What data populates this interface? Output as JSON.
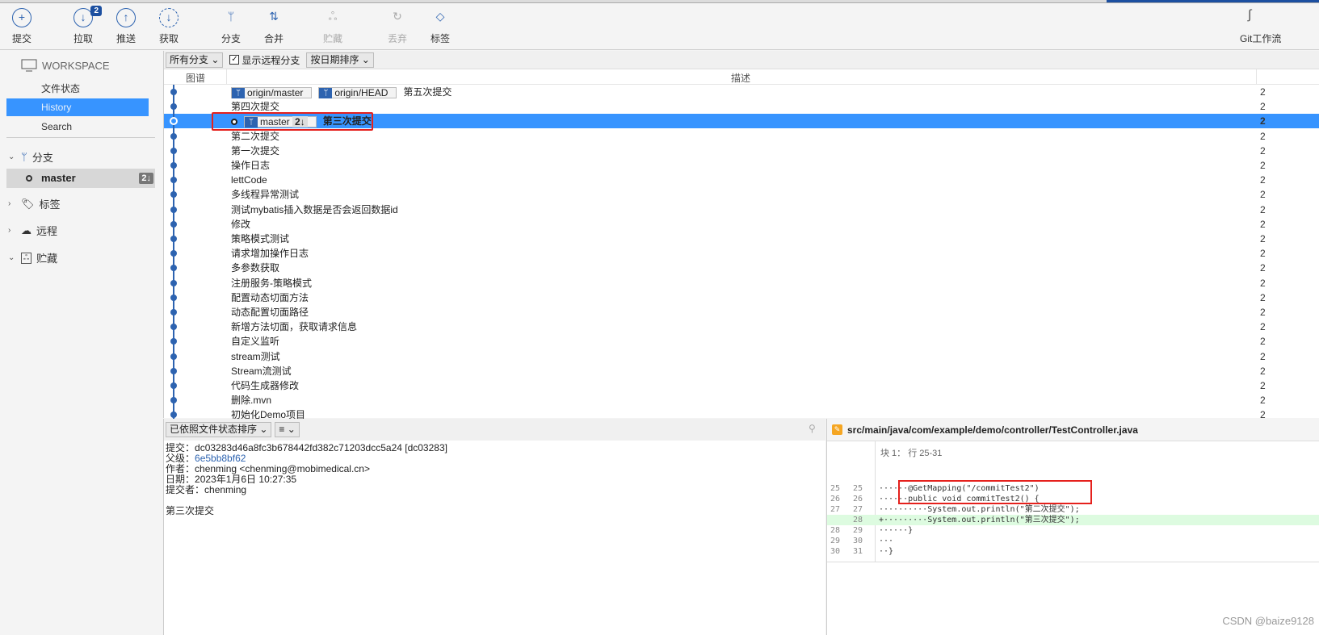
{
  "toolbar": {
    "items": [
      {
        "label": "提交",
        "icon": "plus-circle-icon"
      },
      {
        "label": "拉取",
        "icon": "pull-icon",
        "badge": "2"
      },
      {
        "label": "推送",
        "icon": "push-icon"
      },
      {
        "label": "获取",
        "icon": "fetch-icon"
      },
      {
        "label": "分支",
        "icon": "branch-icon"
      },
      {
        "label": "合并",
        "icon": "merge-icon"
      },
      {
        "label": "贮藏",
        "icon": "stash-icon",
        "disabled": true
      },
      {
        "label": "丢弃",
        "icon": "discard-icon",
        "disabled": true
      },
      {
        "label": "标签",
        "icon": "tag-icon"
      }
    ],
    "git_flow": "Git工作流"
  },
  "sidebar": {
    "workspace": "WORKSPACE",
    "items": [
      "文件状态",
      "History",
      "Search"
    ],
    "selected": "History",
    "branches": "分支",
    "master": "master",
    "master_count": "2↓",
    "tags": "标签",
    "remotes": "远程",
    "stashes": "贮藏"
  },
  "filter": {
    "branches": "所有分支",
    "show_remote": "显示远程分支",
    "show_remote_checked": true,
    "sort": "按日期排序"
  },
  "columns": {
    "graph": "图谱",
    "desc": "描述",
    "date": "2"
  },
  "commits": [
    {
      "desc": "第五次提交",
      "refs": [
        "origin/master",
        "origin/HEAD"
      ]
    },
    {
      "desc": "第四次提交"
    },
    {
      "desc": "第三次提交",
      "refs": [
        "master"
      ],
      "ref_count": "2↓",
      "selected": true,
      "head": true
    },
    {
      "desc": "第二次提交"
    },
    {
      "desc": "第一次提交"
    },
    {
      "desc": "操作日志"
    },
    {
      "desc": "lettCode"
    },
    {
      "desc": "多线程异常测试"
    },
    {
      "desc": "测试mybatis插入数据是否会返回数据id"
    },
    {
      "desc": "修改"
    },
    {
      "desc": "策略模式测试"
    },
    {
      "desc": "请求增加操作日志"
    },
    {
      "desc": "多参数获取"
    },
    {
      "desc": "注册服务-策略模式"
    },
    {
      "desc": "配置动态切面方法"
    },
    {
      "desc": "动态配置切面路径"
    },
    {
      "desc": "新增方法切面，获取请求信息"
    },
    {
      "desc": "自定义监听"
    },
    {
      "desc": "stream测试"
    },
    {
      "desc": "Stream流测试"
    },
    {
      "desc": "代码生成器修改"
    },
    {
      "desc": "删除.mvn"
    },
    {
      "desc": "初始化Demo项目"
    }
  ],
  "details": {
    "sort": "已依照文件状态排序",
    "view": "≡",
    "commit_label": "提交：",
    "commit": "dc03283d46a8fc3b678442fd382c71203dcc5a24 [dc03283]",
    "parent_label": "父级：",
    "parent": "6e5bb8bf62",
    "author_label": "作者：",
    "author": "chenming <chenming@mobimedical.cn>",
    "date_label": "日期：",
    "date": "2023年1月6日 10:27:35",
    "committer_label": "提交者：",
    "committer": "chenming",
    "message": "第三次提交"
  },
  "diff": {
    "file": "src/main/java/com/example/demo/controller/TestController.java",
    "hunk": "块 1： 行 25-31",
    "lines": [
      {
        "a": "25",
        "b": "25",
        "text": "······@GetMapping(\"/commitTest2\")"
      },
      {
        "a": "26",
        "b": "26",
        "text": "······public void commitTest2() {"
      },
      {
        "a": "27",
        "b": "27",
        "text": "··········System.out.println(\"第二次提交\");"
      },
      {
        "a": "",
        "b": "28",
        "text": "+·········System.out.println(\"第三次提交\");",
        "added": true
      },
      {
        "a": "28",
        "b": "29",
        "text": "······}"
      },
      {
        "a": "29",
        "b": "30",
        "text": "···"
      },
      {
        "a": "30",
        "b": "31",
        "text": "··}"
      }
    ]
  },
  "watermark": "CSDN @baize9128",
  "colors": {
    "accent": "#3794ff",
    "graph": "#2d63b0",
    "highlight_box": "#e5211d",
    "added_line": "#ddfbe0"
  }
}
